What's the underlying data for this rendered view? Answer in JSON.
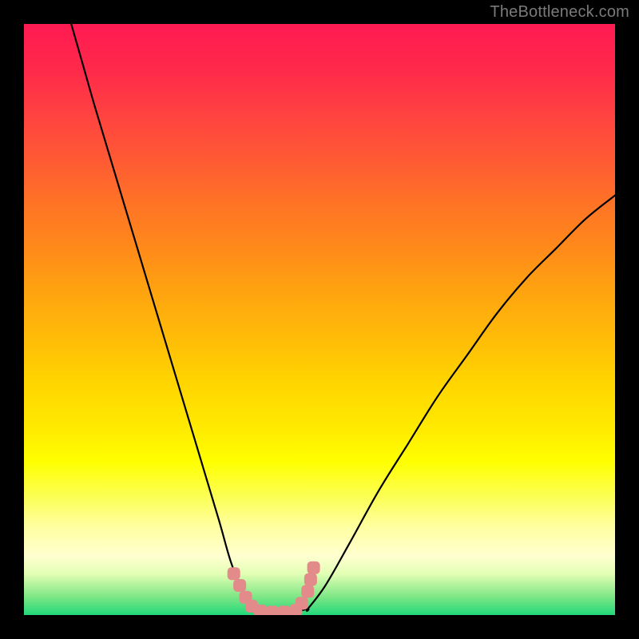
{
  "watermark": "TheBottleneck.com",
  "chart_data": {
    "type": "line",
    "title": "",
    "xlabel": "",
    "ylabel": "",
    "xlim": [
      0,
      100
    ],
    "ylim": [
      0,
      100
    ],
    "grid": false,
    "legend": false,
    "series": [
      {
        "name": "left-curve",
        "x": [
          8,
          10,
          12,
          15,
          18,
          21,
          24,
          27,
          30,
          33,
          35,
          37,
          39
        ],
        "y": [
          100,
          93,
          86,
          76,
          66,
          56,
          46,
          36,
          26,
          16,
          9,
          4,
          1
        ]
      },
      {
        "name": "bottom-flat",
        "x": [
          39,
          42,
          45,
          48
        ],
        "y": [
          1,
          0.5,
          0.5,
          1
        ]
      },
      {
        "name": "right-curve",
        "x": [
          48,
          51,
          55,
          60,
          65,
          70,
          75,
          80,
          85,
          90,
          95,
          100
        ],
        "y": [
          1,
          5,
          12,
          21,
          29,
          37,
          44,
          51,
          57,
          62,
          67,
          71
        ]
      }
    ],
    "bottom_marker": {
      "name": "bottleneck-range-marker",
      "color": "#e38a8a",
      "points_x": [
        35.5,
        36.5,
        37.5,
        38.5,
        40,
        42,
        44,
        46,
        47,
        48,
        48.5,
        49
      ],
      "points_y": [
        7,
        5,
        3,
        1.5,
        0.7,
        0.5,
        0.5,
        0.8,
        2,
        4,
        6,
        8
      ]
    },
    "background_gradient": {
      "top": "#ff1a52",
      "mid": "#ffff00",
      "bottom": "#22d97b"
    }
  }
}
